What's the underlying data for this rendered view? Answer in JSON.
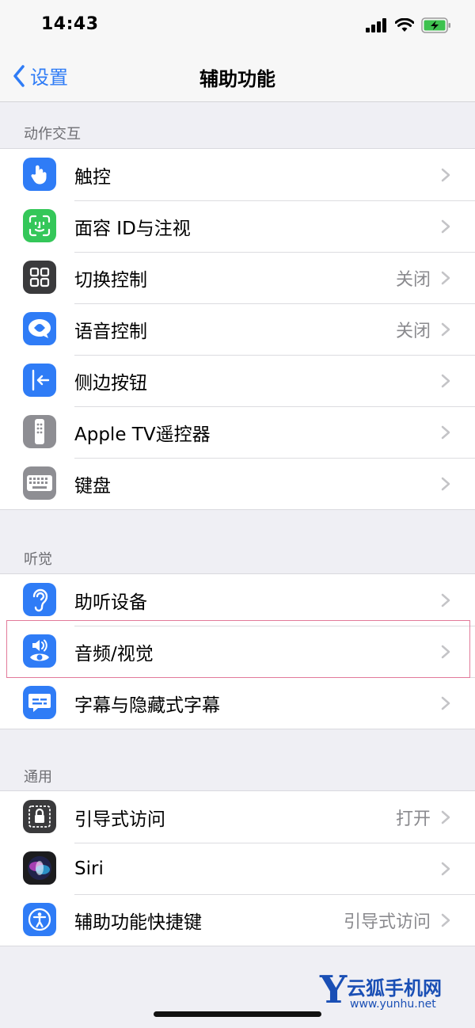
{
  "status_bar": {
    "time": "14:43"
  },
  "nav": {
    "back_label": "设置",
    "title": "辅助功能"
  },
  "sections": [
    {
      "header": "动作交互",
      "items": [
        {
          "label": "触控",
          "value": "",
          "icon": "touch-hand-icon",
          "color": "#2f7cf6"
        },
        {
          "label": "面容 ID与注视",
          "value": "",
          "icon": "face-id-icon",
          "color": "#34c759"
        },
        {
          "label": "切换控制",
          "value": "关闭",
          "icon": "switch-control-icon",
          "color": "#3a3a3c"
        },
        {
          "label": "语音控制",
          "value": "关闭",
          "icon": "voice-control-icon",
          "color": "#2f7cf6"
        },
        {
          "label": "侧边按钮",
          "value": "",
          "icon": "side-button-icon",
          "color": "#2f7cf6"
        },
        {
          "label": "Apple TV遥控器",
          "value": "",
          "icon": "tv-remote-icon",
          "color": "#8e8e93"
        },
        {
          "label": "键盘",
          "value": "",
          "icon": "keyboard-icon",
          "color": "#8e8e93"
        }
      ]
    },
    {
      "header": "听觉",
      "items": [
        {
          "label": "助听设备",
          "value": "",
          "icon": "ear-icon",
          "color": "#2f7cf6"
        },
        {
          "label": "音频/视觉",
          "value": "",
          "icon": "audio-visual-icon",
          "color": "#2f7cf6"
        },
        {
          "label": "字幕与隐藏式字幕",
          "value": "",
          "icon": "captions-icon",
          "color": "#2f7cf6"
        }
      ]
    },
    {
      "header": "通用",
      "items": [
        {
          "label": "引导式访问",
          "value": "打开",
          "icon": "guided-access-lock-icon",
          "color": "#3a3a3c"
        },
        {
          "label": "Siri",
          "value": "",
          "icon": "siri-icon",
          "color": "#1c1c1e"
        },
        {
          "label": "辅助功能快捷键",
          "value": "引导式访问",
          "icon": "accessibility-icon",
          "color": "#2f7cf6"
        }
      ]
    }
  ],
  "watermark": {
    "letter": "Y",
    "name": "云狐手机网",
    "url": "www.yunhu.net"
  }
}
